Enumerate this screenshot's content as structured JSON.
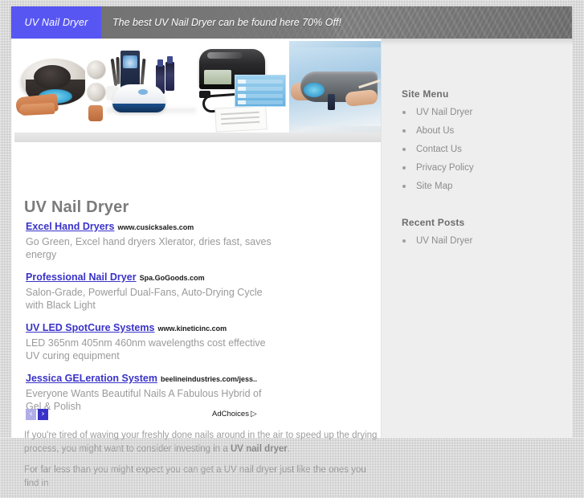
{
  "header": {
    "logo_label": "UV Nail Dryer",
    "tagline": "The best UV Nail Dryer can be found here 70% Off!",
    "logo_color": "#5756f3",
    "bar_color": "#7d7d7d"
  },
  "main": {
    "page_title": "UV Nail Dryer",
    "banner_alt": "uv-nail-dryer-product-collage"
  },
  "ads": {
    "items": [
      {
        "title": "Excel Hand Dryers",
        "url": "www.cusicksales.com",
        "description": "Go Green, Excel hand dryers Xlerator, dries fast, saves energy"
      },
      {
        "title": "Professional Nail Dryer",
        "url": "Spa.GoGoods.com",
        "description": "Salon-Grade, Powerful Dual-Fans, Auto-Drying Cycle with Black Light"
      },
      {
        "title": "UV LED SpotCure Systems",
        "url": "www.kineticinc.com",
        "description": "LED 365nm 405nm 460nm wavelengths cost effective UV curing equipment"
      },
      {
        "title": "Jessica GELeration System",
        "url": "beelineindustries.com/jess..",
        "description": "Everyone Wants Beautiful Nails A Fabulous Hybrid of Gel & Polish"
      }
    ],
    "prev_label": "‹",
    "next_label": "›",
    "adchoices_label": "AdChoices",
    "adchoices_icon": "▷",
    "link_color": "#3a32c8"
  },
  "article": {
    "paragraph1_before": "If you're tired of waving your freshly done nails around in the air to speed up the drying process, you might want to consider investing in a ",
    "paragraph1_bold": "UV nail dryer",
    "paragraph1_after": ".",
    "paragraph2": "For far less than you might expect you can get a UV nail dryer just like the ones you find in"
  },
  "sidebar": {
    "menu_heading": "Site Menu",
    "menu_items": [
      {
        "label": "UV Nail Dryer"
      },
      {
        "label": "About Us"
      },
      {
        "label": "Contact Us"
      },
      {
        "label": "Privacy Policy"
      },
      {
        "label": "Site Map"
      }
    ],
    "posts_heading": "Recent Posts",
    "posts_items": [
      {
        "label": "UV Nail Dryer"
      }
    ]
  }
}
